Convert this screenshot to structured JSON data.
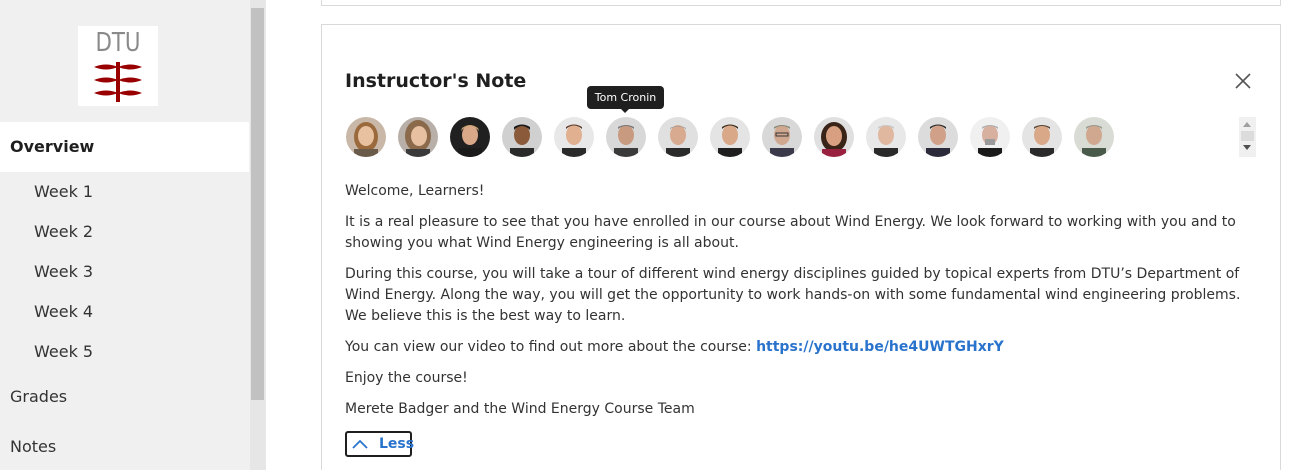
{
  "sidebar": {
    "logo_text": "DTU",
    "overview_label": "Overview",
    "weeks": [
      "Week 1",
      "Week 2",
      "Week 3",
      "Week 4",
      "Week 5"
    ],
    "grades_label": "Grades",
    "notes_label": "Notes"
  },
  "note": {
    "title": "Instructor's Note",
    "tooltip": "Tom Cronin",
    "greeting": "Welcome, Learners!",
    "paragraph1": "It is a real pleasure to see that you have enrolled in our course about Wind Energy. We look forward to working with you and to showing you what Wind Energy engineering is all about.",
    "paragraph2": "During this course, you will take a tour of different wind energy disciplines guided by topical experts from DTU’s Department of Wind Energy. Along the way, you will get the opportunity to work hands-on with some fundamental wind engineering problems. We believe this is the best way to learn.",
    "video_prefix": "You can view our video to find out more about the course: ",
    "video_link": "https://youtu.be/he4UWTGHxrY",
    "enjoy": "Enjoy the course!",
    "signature": "Merete Badger and the Wind Energy Course Team",
    "less_label": "Less"
  },
  "icons": {
    "close": "close-icon",
    "collapse": "chevron-up-icon",
    "scroll_up": "arrow-up-icon",
    "scroll_down": "arrow-down-icon"
  },
  "colors": {
    "link": "#2a73cc",
    "logo_red": "#990000",
    "sidebar_bg": "#f0f0f0"
  }
}
